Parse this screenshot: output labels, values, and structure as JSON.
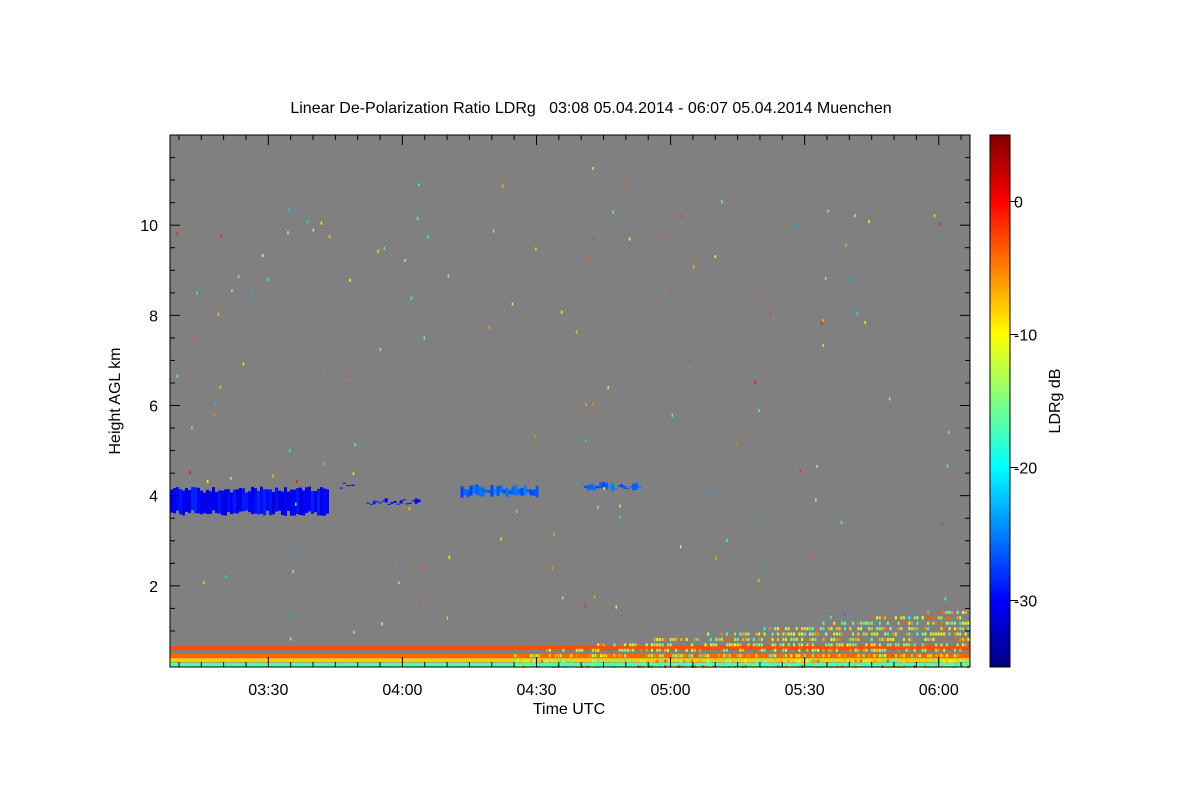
{
  "chart_data": {
    "type": "heatmap",
    "title": "Linear De-Polarization Ratio LDRg   03:08 05.04.2014 - 06:07 05.04.2014 Muenchen",
    "xlabel": "Time UTC",
    "ylabel": "Height AGL km",
    "x_range": [
      "03:08",
      "06:07"
    ],
    "x_ticks": [
      "03:30",
      "04:00",
      "04:30",
      "05:00",
      "05:30",
      "06:00"
    ],
    "ylim": [
      0.2,
      12.0
    ],
    "y_ticks": [
      2,
      4,
      6,
      8,
      10
    ],
    "background_color": "#808080",
    "colorbar": {
      "label": "LDRg dB",
      "range": [
        -35,
        5
      ],
      "ticks": [
        0,
        -10,
        -20,
        -30
      ],
      "colormap": "jet"
    },
    "features": [
      {
        "time_start": "03:08",
        "time_end": "03:43",
        "height_bottom": 3.55,
        "height_top": 4.2,
        "ldr_db": -30
      },
      {
        "time_start": "03:46",
        "time_end": "03:49",
        "height_bottom": 4.15,
        "height_top": 4.3,
        "ldr_db": -30
      },
      {
        "time_start": "03:52",
        "time_end": "04:04",
        "height_bottom": 3.8,
        "height_top": 3.95,
        "ldr_db": -30
      },
      {
        "time_start": "04:13",
        "time_end": "04:30",
        "height_bottom": 3.95,
        "height_top": 4.25,
        "ldr_db": -26
      },
      {
        "time_start": "04:40",
        "time_end": "04:53",
        "height_bottom": 4.1,
        "height_top": 4.3,
        "ldr_db": -26
      }
    ]
  }
}
